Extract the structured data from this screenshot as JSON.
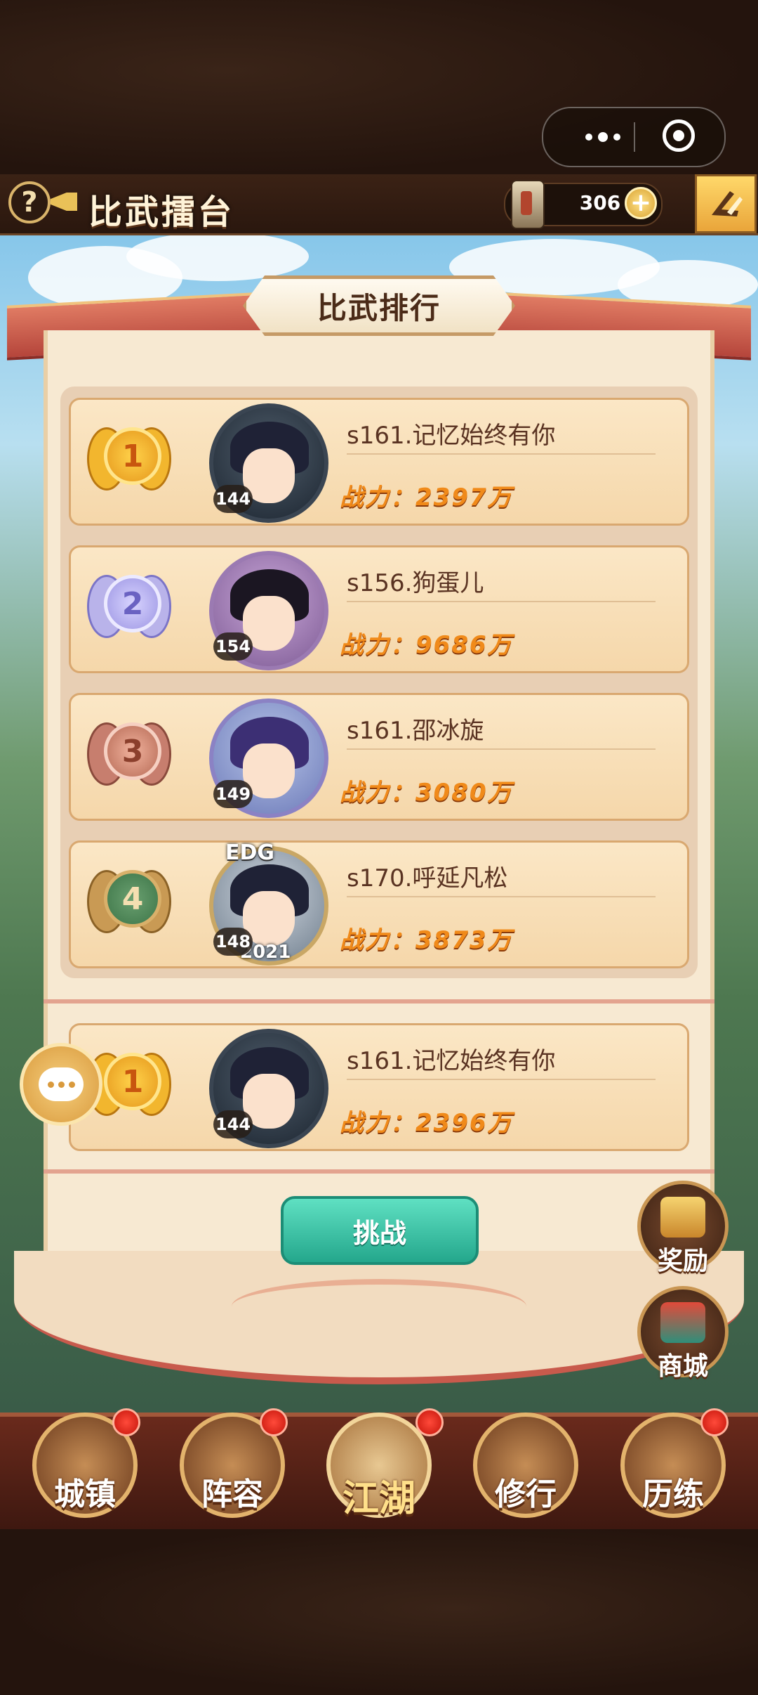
{
  "header": {
    "help_icon": "?",
    "title": "比武擂台",
    "resource_count": "306",
    "plus_icon": "+"
  },
  "panel": {
    "tab_title": "比武排行"
  },
  "ranking": [
    {
      "rank": "1",
      "level": "144",
      "name": "s161.记忆始终有你",
      "power": "战力：2397万"
    },
    {
      "rank": "2",
      "level": "154",
      "name": "s156.狗蛋儿",
      "power": "战力：9686万"
    },
    {
      "rank": "3",
      "level": "149",
      "name": "s161.邵冰旋",
      "power": "战力：3080万"
    },
    {
      "rank": "4",
      "level": "148",
      "name": "s170.呼延凡松",
      "power": "战力：3873万",
      "frame_top": "EDG",
      "frame_bottom": "2021"
    }
  ],
  "self_entry": {
    "rank": "1",
    "level": "144",
    "name": "s161.记忆始终有你",
    "power": "战力：2396万"
  },
  "actions": {
    "challenge_label": "挑战",
    "reward_label": "奖励",
    "shop_label": "商城"
  },
  "nav": [
    {
      "label": "城镇",
      "icon": "town-icon",
      "badge": true
    },
    {
      "label": "阵容",
      "icon": "lineup-icon",
      "badge": true
    },
    {
      "label": "江湖",
      "icon": "jianghu-scroll-icon",
      "badge": true
    },
    {
      "label": "修行",
      "icon": "cultivation-icon",
      "badge": false
    },
    {
      "label": "历练",
      "icon": "training-icon",
      "badge": true
    }
  ],
  "colors": {
    "accent_gold": "#e9c158",
    "power_orange": "#f08a1a",
    "challenge_teal": "#24a78c",
    "badge_red": "#e0261a"
  }
}
